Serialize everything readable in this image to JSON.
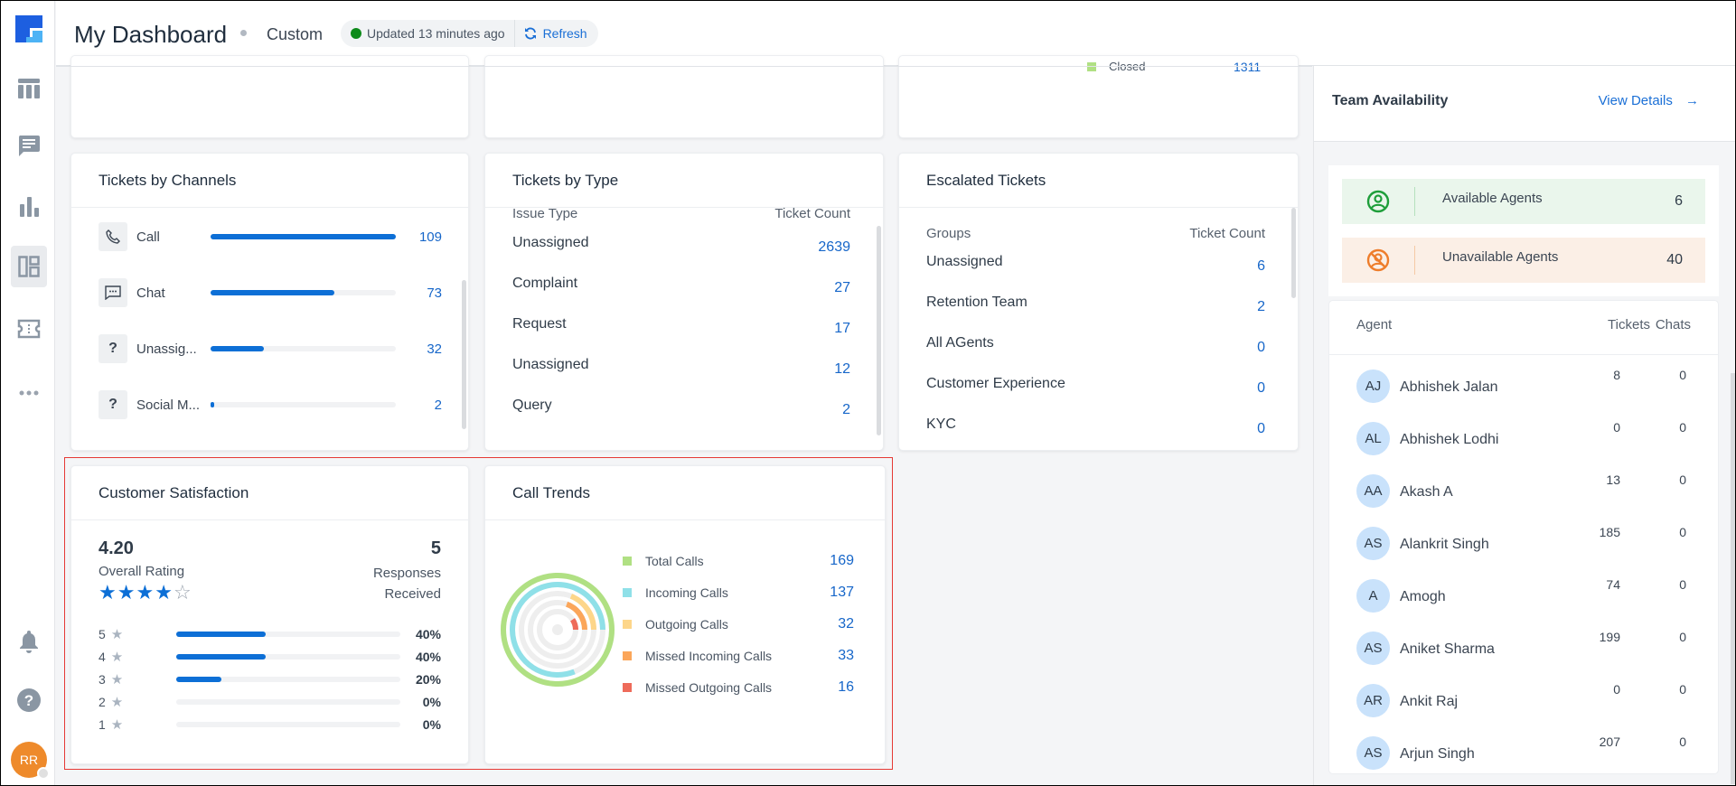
{
  "header": {
    "title": "My Dashboard",
    "subtitle": "Custom",
    "updated_text": "Updated 13 minutes ago",
    "refresh_label": "Refresh"
  },
  "sidebar": {
    "items": [
      {
        "icon": "table-icon",
        "label": "Tickets list"
      },
      {
        "icon": "chat-icon",
        "label": "Chat"
      },
      {
        "icon": "bar-chart-icon",
        "label": "Analytics"
      },
      {
        "icon": "dashboard-icon",
        "label": "Dashboard",
        "active": true
      },
      {
        "icon": "ticket-icon",
        "label": "Tickets"
      },
      {
        "icon": "more-icon",
        "label": "More"
      }
    ],
    "bottom": [
      {
        "icon": "bell-icon",
        "label": "Notifications"
      },
      {
        "icon": "help-icon",
        "label": "Help"
      }
    ],
    "user_initials": "RR"
  },
  "top_partial": {
    "legend_label": "Closed",
    "legend_value": "1311"
  },
  "tickets_by_channels": {
    "title": "Tickets by Channels",
    "rows": [
      {
        "label": "Call",
        "value": "109",
        "fraction": 1.0,
        "icon": "phone-icon"
      },
      {
        "label": "Chat",
        "value": "73",
        "fraction": 0.67,
        "icon": "chat-bubble-icon"
      },
      {
        "label": "Unassig...",
        "value": "32",
        "fraction": 0.29,
        "icon": "question-icon"
      },
      {
        "label": "Social M...",
        "value": "2",
        "fraction": 0.02,
        "icon": "question-icon"
      }
    ]
  },
  "tickets_by_type": {
    "title": "Tickets by Type",
    "col1": "Issue Type",
    "col2": "Ticket Count",
    "rows": [
      {
        "label": "Unassigned",
        "value": "2639"
      },
      {
        "label": "Complaint",
        "value": "27"
      },
      {
        "label": "Request",
        "value": "17"
      },
      {
        "label": "Unassigned",
        "value": "12"
      },
      {
        "label": "Query",
        "value": "2"
      }
    ]
  },
  "escalated_tickets": {
    "title": "Escalated Tickets",
    "col1": "Groups",
    "col2": "Ticket Count",
    "rows": [
      {
        "label": "Unassigned",
        "value": "6"
      },
      {
        "label": "Retention Team",
        "value": "2"
      },
      {
        "label": "All AGents",
        "value": "0"
      },
      {
        "label": "Customer Experience",
        "value": "0"
      },
      {
        "label": "KYC",
        "value": "0"
      }
    ]
  },
  "customer_satisfaction": {
    "title": "Customer Satisfaction",
    "score": "4.20",
    "score_label": "Overall Rating",
    "stars_filled": 4,
    "stars_total": 5,
    "responses": "5",
    "responses_label": "Responses Received",
    "ratings": [
      {
        "stars": "5",
        "pct": "40%",
        "fraction": 0.4
      },
      {
        "stars": "4",
        "pct": "40%",
        "fraction": 0.4
      },
      {
        "stars": "3",
        "pct": "20%",
        "fraction": 0.2
      },
      {
        "stars": "2",
        "pct": "0%",
        "fraction": 0
      },
      {
        "stars": "1",
        "pct": "0%",
        "fraction": 0
      }
    ]
  },
  "call_trends": {
    "title": "Call Trends",
    "series": [
      {
        "label": "Total Calls",
        "value": "169",
        "color": "#b0e083"
      },
      {
        "label": "Incoming Calls",
        "value": "137",
        "color": "#8fe0e8"
      },
      {
        "label": "Outgoing Calls",
        "value": "32",
        "color": "#fdd68a"
      },
      {
        "label": "Missed Incoming Calls",
        "value": "33",
        "color": "#fba65a"
      },
      {
        "label": "Missed Outgoing Calls",
        "value": "16",
        "color": "#ee6b5a"
      }
    ]
  },
  "team_availability": {
    "title": "Team Availability",
    "view_details": "View Details",
    "available_label": "Available Agents",
    "available_count": "6",
    "unavailable_label": "Unavailable Agents",
    "unavailable_count": "40",
    "columns": {
      "agent": "Agent",
      "tickets": "Tickets",
      "chats": "Chats"
    },
    "agents": [
      {
        "initials": "AJ",
        "name": "Abhishek Jalan",
        "tickets": "8",
        "chats": "0"
      },
      {
        "initials": "AL",
        "name": "Abhishek Lodhi",
        "tickets": "0",
        "chats": "0"
      },
      {
        "initials": "AA",
        "name": "Akash A",
        "tickets": "13",
        "chats": "0"
      },
      {
        "initials": "AS",
        "name": "Alankrit Singh",
        "tickets": "185",
        "chats": "0"
      },
      {
        "initials": "A",
        "name": "Amogh",
        "tickets": "74",
        "chats": "0"
      },
      {
        "initials": "AS",
        "name": "Aniket Sharma",
        "tickets": "199",
        "chats": "0"
      },
      {
        "initials": "AR",
        "name": "Ankit Raj",
        "tickets": "0",
        "chats": "0"
      },
      {
        "initials": "AS",
        "name": "Arjun Singh",
        "tickets": "207",
        "chats": "0"
      }
    ]
  },
  "colors": {
    "accent": "#1666c9",
    "bar": "#0d6fd6",
    "available_bg": "#eaf6ec",
    "available_fg": "#1e9e3a",
    "unavailable_bg": "#fbefe6",
    "unavailable_fg": "#ee7d2b"
  }
}
